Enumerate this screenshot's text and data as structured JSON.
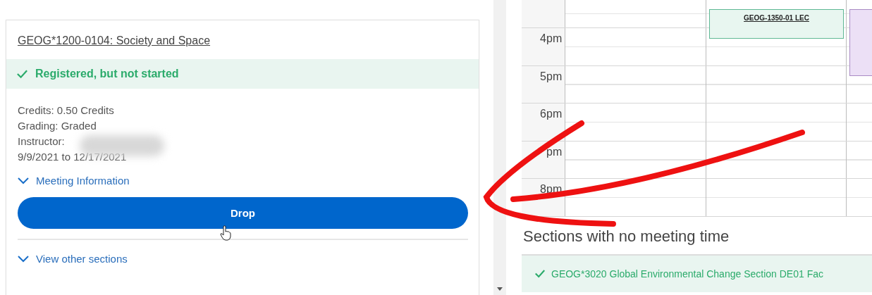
{
  "course": {
    "title": "GEOG*1200-0104: Society and Space",
    "status": {
      "kind": "success",
      "text": "Registered, but not started"
    },
    "details": [
      "Credits: 0.50 Credits",
      "Grading: Graded",
      "Instructor:",
      "9/9/2021 to 12/17/2021"
    ],
    "meeting_toggle": {
      "label": "Meeting Information",
      "expanded": false
    },
    "drop_button": "Drop",
    "other_sections_toggle": {
      "label": "View other sections",
      "expanded": false
    }
  },
  "calendar": {
    "times": [
      "4pm",
      "5pm",
      "6pm",
      "pm",
      "8pm"
    ],
    "events": [
      {
        "label": "GEOG-1350-01 LEC",
        "color": "#e8f6f0"
      },
      {
        "color": "#ece0f6"
      }
    ]
  },
  "no_meeting": {
    "heading": "Sections with no meeting time",
    "items": [
      {
        "text": "GEOG*3020 Global Environmental Change Section DE01 Fac",
        "registered": true
      }
    ]
  }
}
